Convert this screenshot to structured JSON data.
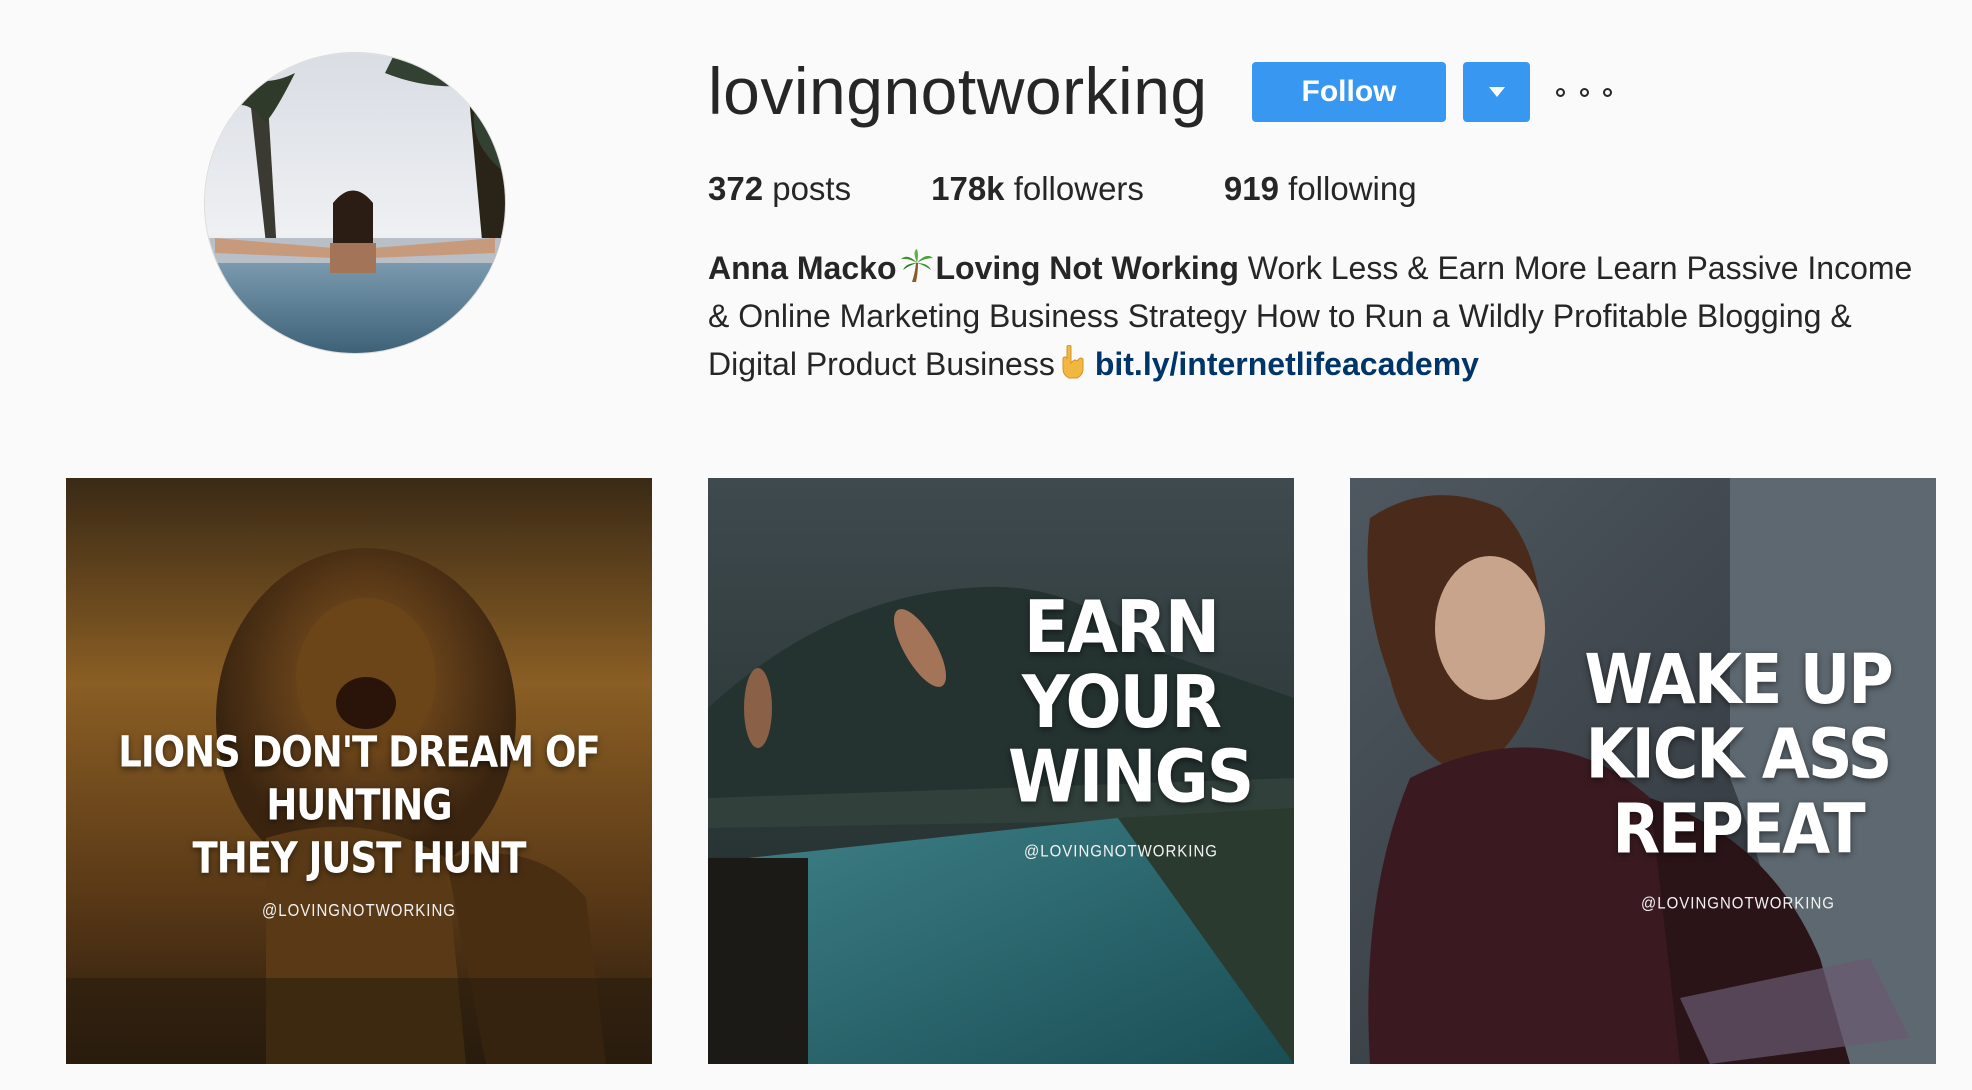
{
  "profile": {
    "username": "lovingnotworking",
    "follow_label": "Follow",
    "stats": {
      "posts_count": "372",
      "posts_label": " posts",
      "followers_count": "178k",
      "followers_label": " followers",
      "following_count": "919",
      "following_label": " following"
    },
    "bio": {
      "name": "Anna Macko",
      "title": "Loving Not Working",
      "text": " Work Less & Earn More Learn Passive Income & Online Marketing Business Strategy How to Run a Wildly Profitable Blogging & Digital Product Business",
      "link": "bit.ly/internetlifeacademy"
    }
  },
  "posts": [
    {
      "caption_line1": "Lions don't dream of hunting",
      "caption_line2": "They just hunt",
      "handle": "@LOVINGNOTWORKING"
    },
    {
      "caption_line1": "Earn",
      "caption_line2": "Your",
      "caption_line3": "Wings",
      "handle": "@LOVINGNOTWORKING"
    },
    {
      "caption_line1": "Wake up",
      "caption_line2": "Kick ass",
      "caption_line3": "Repeat",
      "handle": "@LOVINGNOTWORKING"
    }
  ],
  "colors": {
    "accent": "#3897f0",
    "link": "#003569",
    "background": "#fafafa",
    "text": "#262626"
  },
  "icons": [
    "palm-tree-emoji",
    "pointing-down-emoji",
    "caret-down-icon",
    "more-options-icon"
  ]
}
